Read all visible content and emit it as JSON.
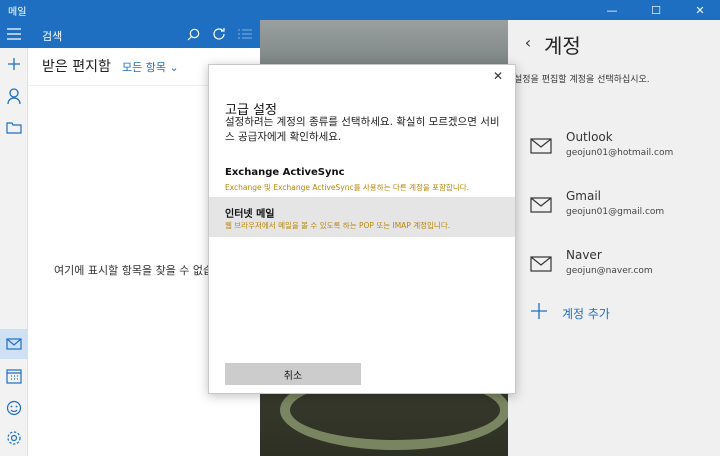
{
  "window": {
    "title": "메일",
    "minimize": "—",
    "maximize": "☐",
    "close": "✕"
  },
  "rail": {
    "icons": [
      "hamburger-icon",
      "compose-icon",
      "person-icon",
      "folder-icon",
      "mail-icon",
      "calendar-icon",
      "smiley-icon",
      "gear-icon"
    ]
  },
  "search": {
    "label": "검색"
  },
  "pane": {
    "inbox_title": "받은 편지함",
    "filter_label": "모든 항목",
    "empty_message": "여기에 표시할 항목을 찾을 수 없습니다"
  },
  "accounts": {
    "title": "계정",
    "subtitle": "설정을 편집할 계정을 선택하십시오.",
    "items": [
      {
        "name": "Outlook",
        "email": "geojun01@hotmail.com"
      },
      {
        "name": "Gmail",
        "email": "geojun01@gmail.com"
      },
      {
        "name": "Naver",
        "email": "geojun@naver.com"
      }
    ],
    "add_label": "계정 추가"
  },
  "dialog": {
    "close": "✕",
    "title": "고급 설정",
    "description": "설정하려는 계정의 종류를 선택하세요. 확실히 모르겠으면 서비스 공급자에게 확인하세요.",
    "options": [
      {
        "title": "Exchange ActiveSync",
        "desc": "Exchange 및 Exchange ActiveSync를 사용하는 다른 계정을 포함합니다."
      },
      {
        "title": "인터넷 메일",
        "desc": "웹 브라우저에서 메일을 볼 수 있도록 하는 POP 또는 IMAP 계정입니다."
      }
    ],
    "cancel_label": "취소"
  },
  "colors": {
    "accent": "#1e6fc1",
    "option_desc": "#b8860b",
    "selected_option": "#e5e5e5"
  }
}
